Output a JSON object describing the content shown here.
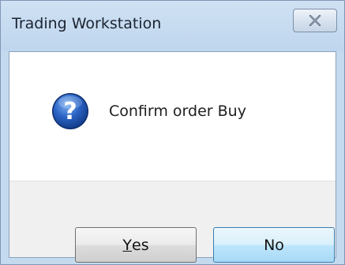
{
  "window": {
    "title": "Trading Workstation",
    "close_glyph": "✕"
  },
  "message": {
    "icon": "question-icon",
    "text": "Confirm order Buy"
  },
  "buttons": {
    "yes_accel": "Y",
    "yes_rest": "es",
    "no_label": "No"
  },
  "colors": {
    "icon_blue": "#2a63c4",
    "default_button_border": "#3c7fb1"
  }
}
